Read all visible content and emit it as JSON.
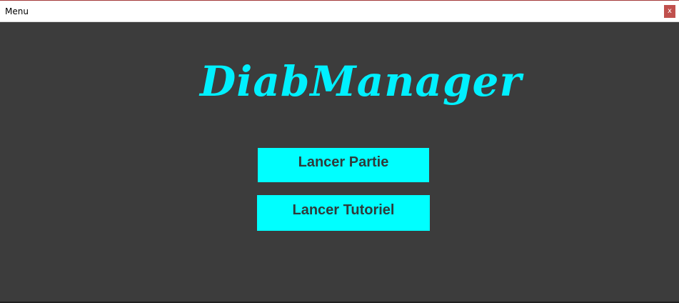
{
  "window": {
    "title": "Menu",
    "close_label": "x"
  },
  "main": {
    "logo_text": "DiabManager",
    "buttons": [
      {
        "label": "Lancer Partie"
      },
      {
        "label": "Lancer Tutoriel"
      }
    ]
  },
  "colors": {
    "background": "#3c3c3c",
    "accent": "#00ffff",
    "close_button": "#c0504d",
    "button_text": "#2f3b3b"
  }
}
